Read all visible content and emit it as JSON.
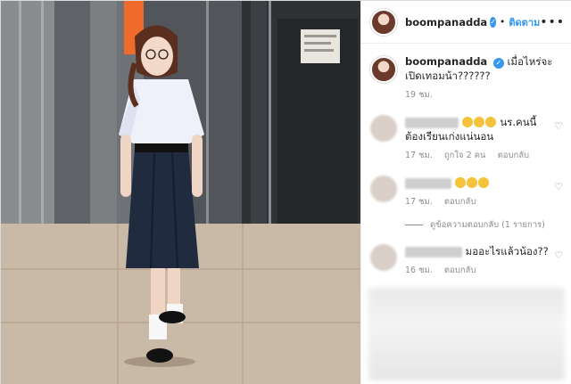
{
  "post": {
    "author": "boompanadda",
    "follow_label": "ติดตาม",
    "separator": "•",
    "more_label": "•••",
    "verified_mark": "✓",
    "caption": {
      "username": "boompanadda",
      "text": "เมื่อไหร่จะเปิดเทอมน้า??????",
      "time": "19 ชม."
    },
    "comments": [
      {
        "text": "นร.คนนี้ ต้องเรียนเก่งแน่นอน",
        "emoji_count": 3,
        "time": "17 ชม.",
        "likes": "ถูกใจ 2 คน",
        "reply_label": "ตอบกลับ"
      },
      {
        "text": "",
        "emoji_count": 3,
        "time": "17 ชม.",
        "likes": "",
        "reply_label": "ตอบกลับ"
      },
      {
        "text": "มออะไรแล้วน้อง??",
        "emoji_count": 0,
        "time": "16 ชม.",
        "likes": "",
        "reply_label": "ตอบกลับ"
      }
    ],
    "view_replies": "ดูข้อความตอบกลับ (1 รายการ)",
    "heart_icon": "heart-icon"
  },
  "colors": {
    "accent": "#3897f0",
    "muted": "#8e8e8e",
    "text": "#262626"
  }
}
